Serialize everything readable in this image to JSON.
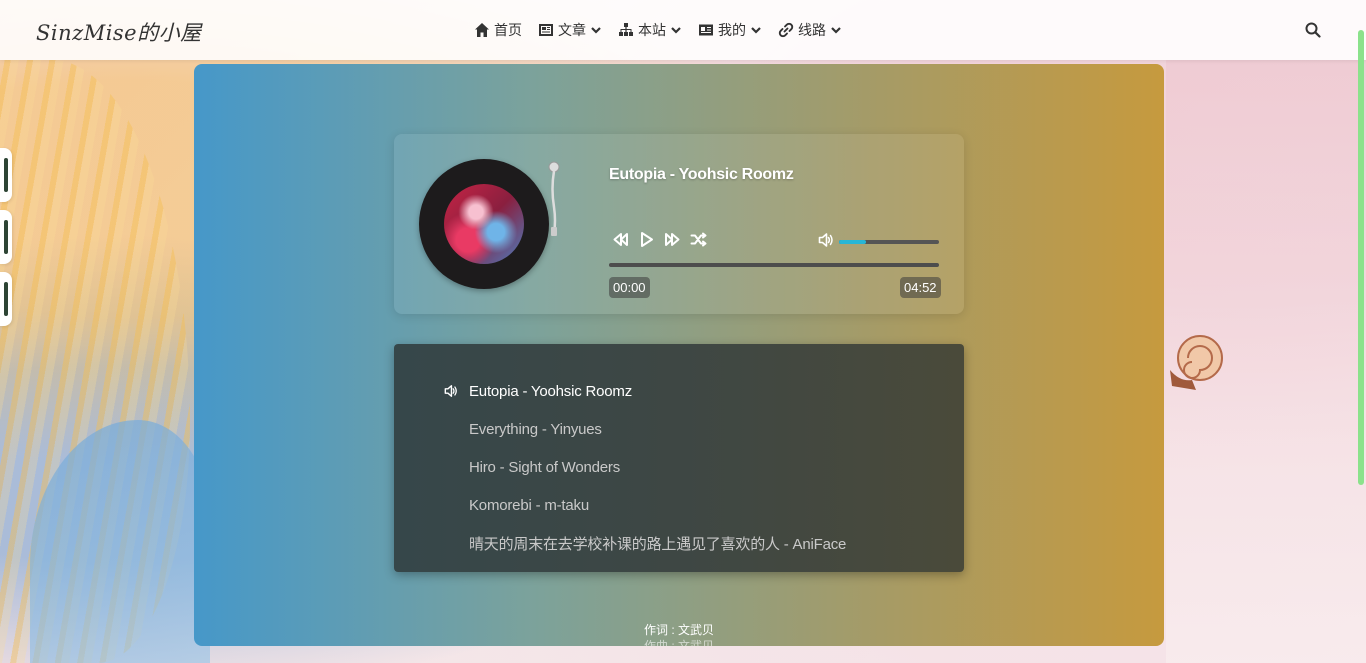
{
  "site": {
    "logo": "SinzMise的小屋"
  },
  "nav": [
    {
      "label": "首页",
      "icon": "home-icon",
      "has_dropdown": false
    },
    {
      "label": "文章",
      "icon": "article-icon",
      "has_dropdown": true
    },
    {
      "label": "本站",
      "icon": "sitemap-icon",
      "has_dropdown": true
    },
    {
      "label": "我的",
      "icon": "id-card-icon",
      "has_dropdown": true
    },
    {
      "label": "线路",
      "icon": "link-icon",
      "has_dropdown": true
    }
  ],
  "player": {
    "current_title": "Eutopia - Yoohsic Roomz",
    "current_time": "00:00",
    "total_time": "04:52",
    "progress": 0.0,
    "volume": 0.27,
    "accent_color": "#28b6d6"
  },
  "playlist": [
    {
      "title": "Eutopia - Yoohsic Roomz",
      "active": true
    },
    {
      "title": "Everything - Yinyues",
      "active": false
    },
    {
      "title": "Hiro - Sight of Wonders",
      "active": false
    },
    {
      "title": "Komorebi - m-taku",
      "active": false
    },
    {
      "title": "晴天的周末在去学校补课的路上遇见了喜欢的人 - AniFace",
      "active": false
    }
  ],
  "credits": {
    "lyricist": "作词 : 文武贝",
    "composer": "作曲 : 文武贝"
  }
}
